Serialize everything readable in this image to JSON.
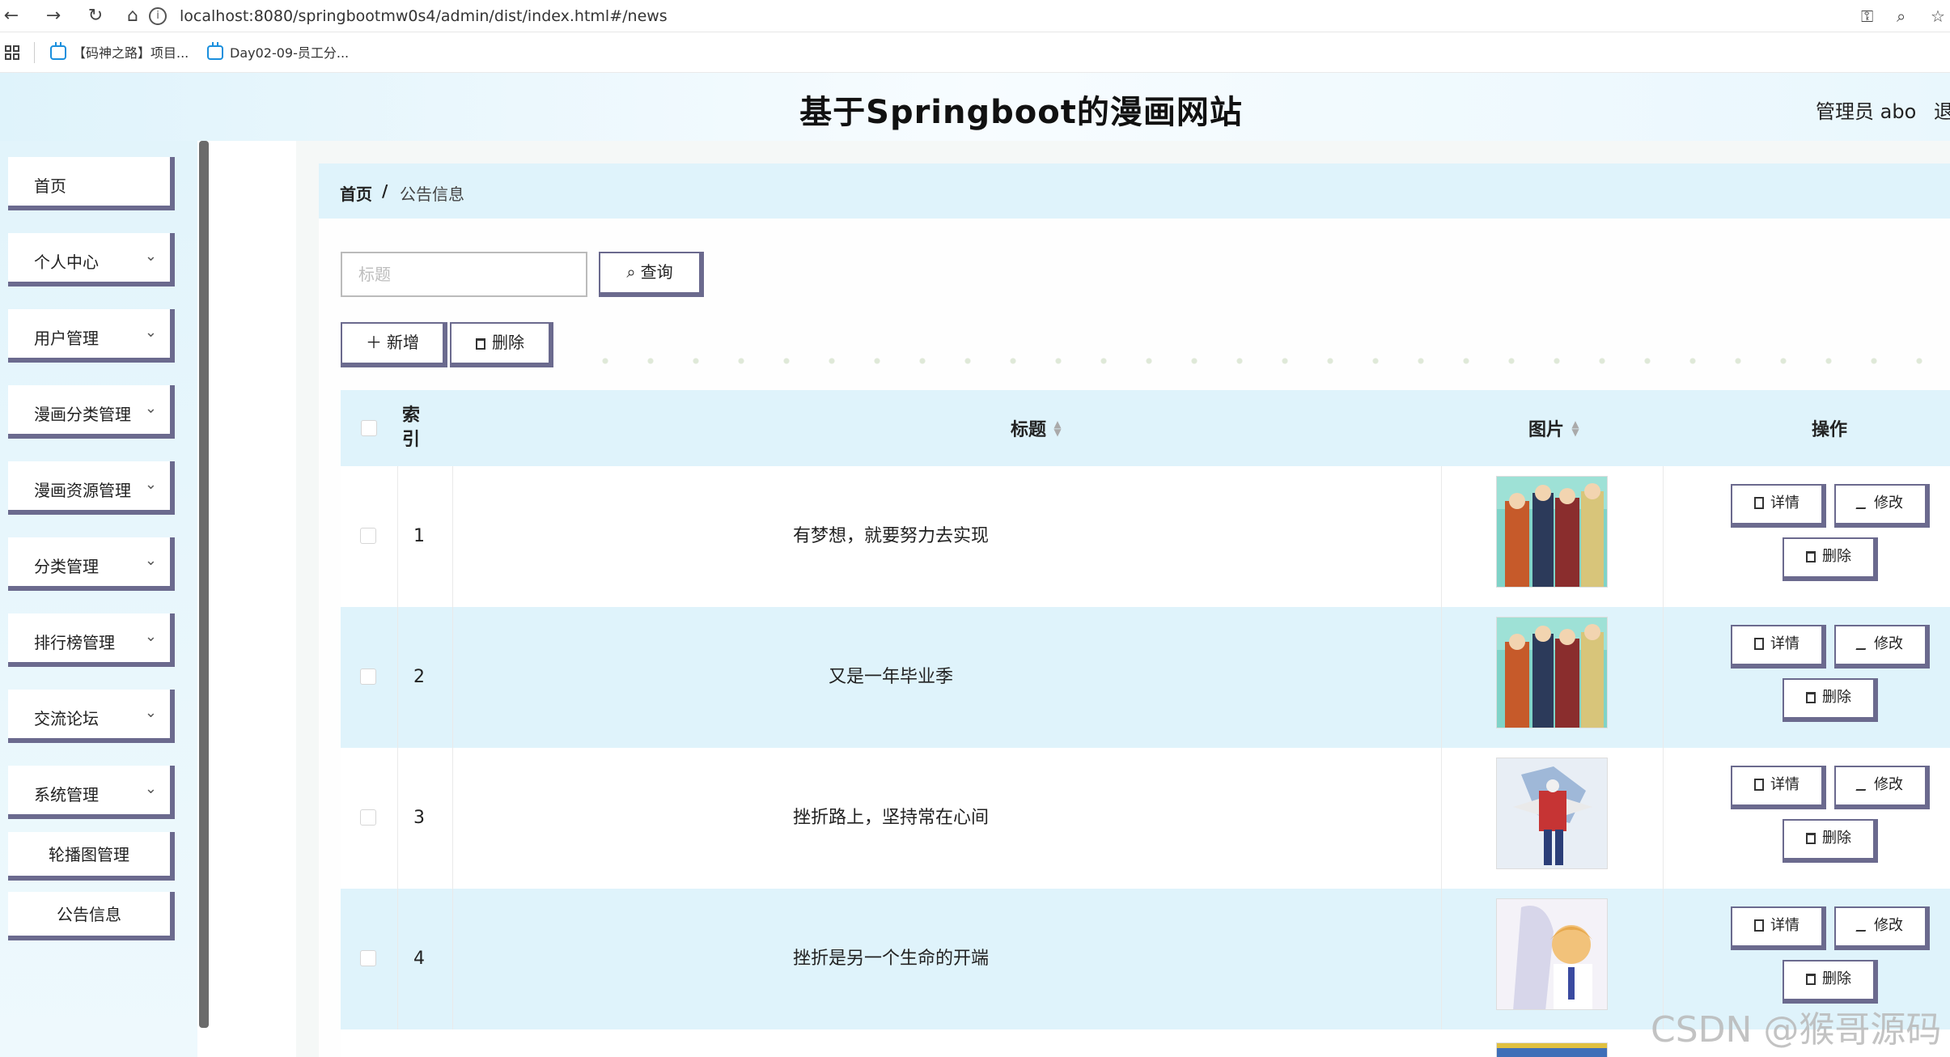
{
  "browser": {
    "url": "localhost:8080/springbootmw0s4/admin/dist/index.html#/news",
    "bookmarks": [
      {
        "label": "【码神之路】项目..."
      },
      {
        "label": "Day02-09-员工分..."
      }
    ]
  },
  "header": {
    "title": "基于Springboot的漫画网站",
    "user": "管理员 abo",
    "logout": "退出登录"
  },
  "sidebar": {
    "items": [
      {
        "label": "首页"
      },
      {
        "label": "个人中心"
      },
      {
        "label": "用户管理"
      },
      {
        "label": "漫画分类管理"
      },
      {
        "label": "漫画资源管理"
      },
      {
        "label": "分类管理"
      },
      {
        "label": "排行榜管理"
      },
      {
        "label": "交流论坛"
      },
      {
        "label": "系统管理"
      }
    ],
    "subitems": [
      {
        "label": "轮播图管理"
      },
      {
        "label": "公告信息"
      }
    ]
  },
  "breadcrumb": {
    "home": "首页",
    "separator": "/",
    "current": "公告信息"
  },
  "search": {
    "placeholder": "标题",
    "value": "",
    "query_label": "查询"
  },
  "toolbar": {
    "add_label": "新增",
    "delete_label": "删除"
  },
  "table": {
    "headers": {
      "index": "索引",
      "title": "标题",
      "image": "图片",
      "actions": "操作"
    },
    "rows": [
      {
        "index": "1",
        "title": "有梦想，就要努力去实现"
      },
      {
        "index": "2",
        "title": "又是一年毕业季"
      },
      {
        "index": "3",
        "title": "挫折路上，坚持常在心间"
      },
      {
        "index": "4",
        "title": "挫折是另一个生命的开端"
      }
    ],
    "actions": {
      "detail": "详情",
      "edit": "修改",
      "delete": "删除"
    }
  },
  "watermark": "CSDN @猴哥源码",
  "colors": {
    "accent_border": "#6b6a8e",
    "light_blue": "#dff3fb"
  }
}
